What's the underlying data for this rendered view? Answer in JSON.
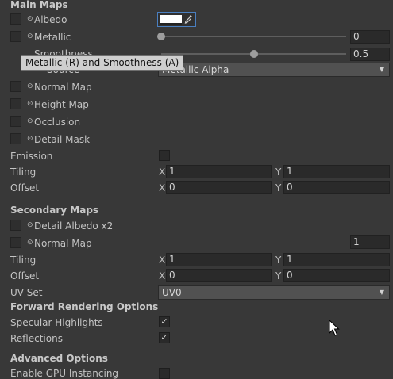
{
  "main_maps": {
    "header": "Main Maps",
    "albedo_label": "Albedo",
    "metallic_label": "Metallic",
    "metallic_value": "0",
    "metallic_level": 0,
    "smoothness_label": "Smoothness",
    "smoothness_value": "0.5",
    "smoothness_level": 0.5,
    "source_label": "Source",
    "source_value": "Metallic Alpha",
    "normal_map_label": "Normal Map",
    "height_map_label": "Height Map",
    "occlusion_label": "Occlusion",
    "detail_mask_label": "Detail Mask",
    "emission_label": "Emission",
    "tiling_label": "Tiling",
    "tiling_x": "1",
    "tiling_y": "1",
    "offset_label": "Offset",
    "offset_x": "0",
    "offset_y": "0"
  },
  "tooltip": "Metallic (R) and Smoothness (A)",
  "secondary_maps": {
    "header": "Secondary Maps",
    "detail_albedo_label": "Detail Albedo x2",
    "normal_map_label": "Normal Map",
    "normal_scale": "1",
    "tiling_label": "Tiling",
    "tiling_x": "1",
    "tiling_y": "1",
    "offset_label": "Offset",
    "offset_x": "0",
    "offset_y": "0",
    "uv_set_label": "UV Set",
    "uv_set_value": "UV0"
  },
  "forward_rendering": {
    "header": "Forward Rendering Options",
    "specular_label": "Specular Highlights",
    "specular_checked": true,
    "reflections_label": "Reflections",
    "reflections_checked": true
  },
  "advanced": {
    "header": "Advanced Options",
    "gpu_instancing_label": "Enable GPU Instancing"
  },
  "axis_labels": {
    "x": "X",
    "y": "Y"
  },
  "glyphs": {
    "check": "✓",
    "dot": "⊙",
    "arrow": "▼"
  },
  "colors": {
    "panel": "#383838",
    "field": "#2a2a2a",
    "albedo_color": "#ffffff"
  }
}
